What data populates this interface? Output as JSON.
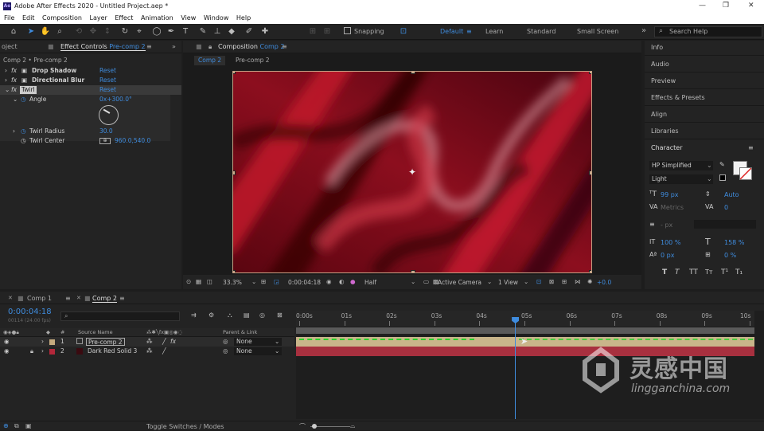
{
  "titlebar": {
    "title": "Adobe After Effects 2020 - Untitled Project.aep *",
    "logo": "Ae"
  },
  "menu": [
    "File",
    "Edit",
    "Composition",
    "Layer",
    "Effect",
    "Animation",
    "View",
    "Window",
    "Help"
  ],
  "toolbar": {
    "snapping": "Snapping",
    "workspaces": [
      "Default",
      "Learn",
      "Standard",
      "Small Screen"
    ],
    "search_placeholder": "Search Help"
  },
  "effects_panel": {
    "tab_left": "oject",
    "tab": "Effect Controls",
    "tab_target": "Pre-comp 2",
    "breadcrumb": "Comp 2 • Pre-comp 2",
    "effects": [
      {
        "name": "Drop Shadow",
        "reset": "Reset"
      },
      {
        "name": "Directional Blur",
        "reset": "Reset"
      },
      {
        "name": "Twirl",
        "reset": "Reset"
      }
    ],
    "angle_label": "Angle",
    "angle_value": "0x+300.0°",
    "radius_label": "Twirl Radius",
    "radius_value": "30.0",
    "center_label": "Twirl Center",
    "center_value": "960.0,540.0"
  },
  "comp_panel": {
    "tab": "Composition",
    "tab_target": "Comp 2",
    "subtabs": [
      "Comp 2",
      "Pre-comp 2"
    ],
    "footer": {
      "zoom": "33.3%",
      "time": "0:00:04:18",
      "resolution": "Half",
      "camera": "Active Camera",
      "views": "1 View",
      "exposure": "+0.0"
    }
  },
  "right_panel": {
    "items": [
      "Info",
      "Audio",
      "Preview",
      "Effects & Presets",
      "Align",
      "Libraries",
      "Character"
    ],
    "character": {
      "font": "HP Simplified",
      "style": "Light",
      "size": "99 px",
      "leading": "Auto",
      "kerning": "Metrics",
      "tracking": "0",
      "stroke": "- px",
      "vscale": "100 %",
      "hscale": "158 %",
      "baseline": "0 px",
      "tsume": "0 %"
    },
    "colors": {
      "fill": "#f2f2f2",
      "stroke": "#ffffff"
    }
  },
  "timeline": {
    "tabs": [
      "Comp 1",
      "Comp 2"
    ],
    "timecode": "0:00:04:18",
    "fps": "00114 (24.00 fps)",
    "search_placeholder": "",
    "col_source": "Source Name",
    "col_parent": "Parent & Link",
    "layers": [
      {
        "num": "1",
        "name": "Pre-comp 2",
        "parent": "None",
        "color": "#c4aa7e"
      },
      {
        "num": "2",
        "name": "Dark Red Solid 3",
        "parent": "None",
        "color": "#b3273a"
      }
    ],
    "ticks": [
      "0:00s",
      "01s",
      "02s",
      "03s",
      "04s",
      "05s",
      "06s",
      "07s",
      "08s",
      "09s",
      "10s"
    ],
    "footer": "Toggle Switches / Modes",
    "playhead_fraction": 0.479
  },
  "watermark": {
    "cn": "灵感中国",
    "en": "lingganchina.com"
  }
}
